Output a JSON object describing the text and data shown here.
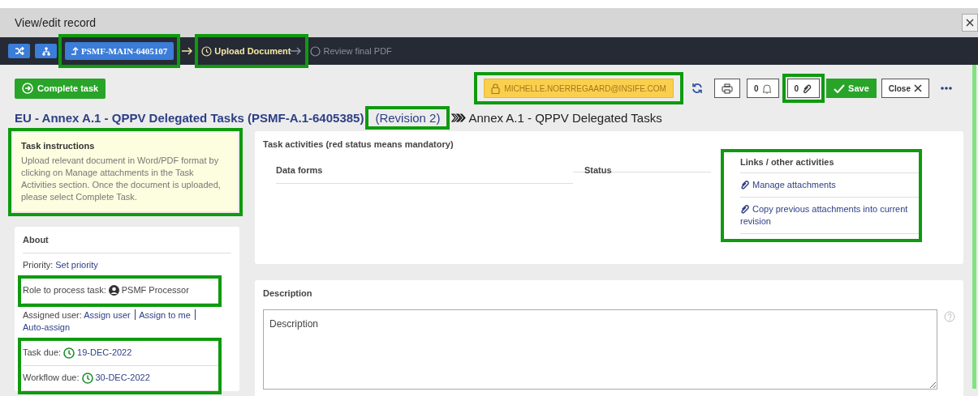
{
  "window": {
    "title": "View/edit record"
  },
  "workflow": {
    "parent": {
      "label": "PSMF-MAIN-6405107",
      "highlighted": true
    },
    "steps": [
      {
        "label": "Upload Document",
        "current": true,
        "highlighted": true
      },
      {
        "label": "Review final PDF",
        "current": false,
        "highlighted": false
      }
    ]
  },
  "toolbar": {
    "complete_button": "Complete task",
    "user_lock": {
      "label": "MICHELLE.NOERREGAARD@INSIFE.COM",
      "highlighted": true
    },
    "notifications": {
      "count": "0",
      "highlighted": false
    },
    "attachments": {
      "count": "0",
      "highlighted": true
    },
    "save_button": "Save",
    "close_button": "Close"
  },
  "heading": {
    "title": "EU - Annex A.1 - QPPV Delegated Tasks (PSMF-A.1-6405385)",
    "revision": {
      "label": "(Revision 2)",
      "highlighted": true
    },
    "subtitle": "Annex A.1 - QPPV Delegated Tasks"
  },
  "instructions": {
    "title": "Task instructions",
    "text": "Upload relevant document in Word/PDF format by clicking on Manage attachments in the Task Activities section. Once the document is uploaded, please select Complete Task.",
    "highlighted": true
  },
  "about": {
    "title": "About",
    "sections": [
      {
        "highlighted": false,
        "rows": [
          {
            "kind": "links",
            "label": "Priority:",
            "links": [
              "Set priority"
            ]
          }
        ]
      },
      {
        "highlighted": true,
        "rows": [
          {
            "kind": "role",
            "label": "Role to process task:",
            "value": "PSMF Processor"
          }
        ]
      },
      {
        "highlighted": false,
        "rows": [
          {
            "kind": "links",
            "label": "Assigned user:",
            "links": [
              "Assign user",
              "Assign to me",
              "Auto-assign"
            ]
          }
        ]
      },
      {
        "highlighted": true,
        "rows": [
          {
            "kind": "date",
            "label": "Task due:",
            "value": "19-DEC-2022"
          },
          {
            "kind": "date",
            "label": "Workflow due:",
            "value": "30-DEC-2022"
          }
        ]
      }
    ]
  },
  "activities": {
    "title": "Task activities (red status means mandatory)",
    "columns": [
      "Data forms",
      "Status"
    ],
    "links_panel": {
      "title": "Links / other activities",
      "highlighted": true,
      "items": [
        "Manage attachments",
        "Copy previous attachments into current revision"
      ]
    }
  },
  "description": {
    "title": "Description",
    "placeholder": "Description"
  }
}
